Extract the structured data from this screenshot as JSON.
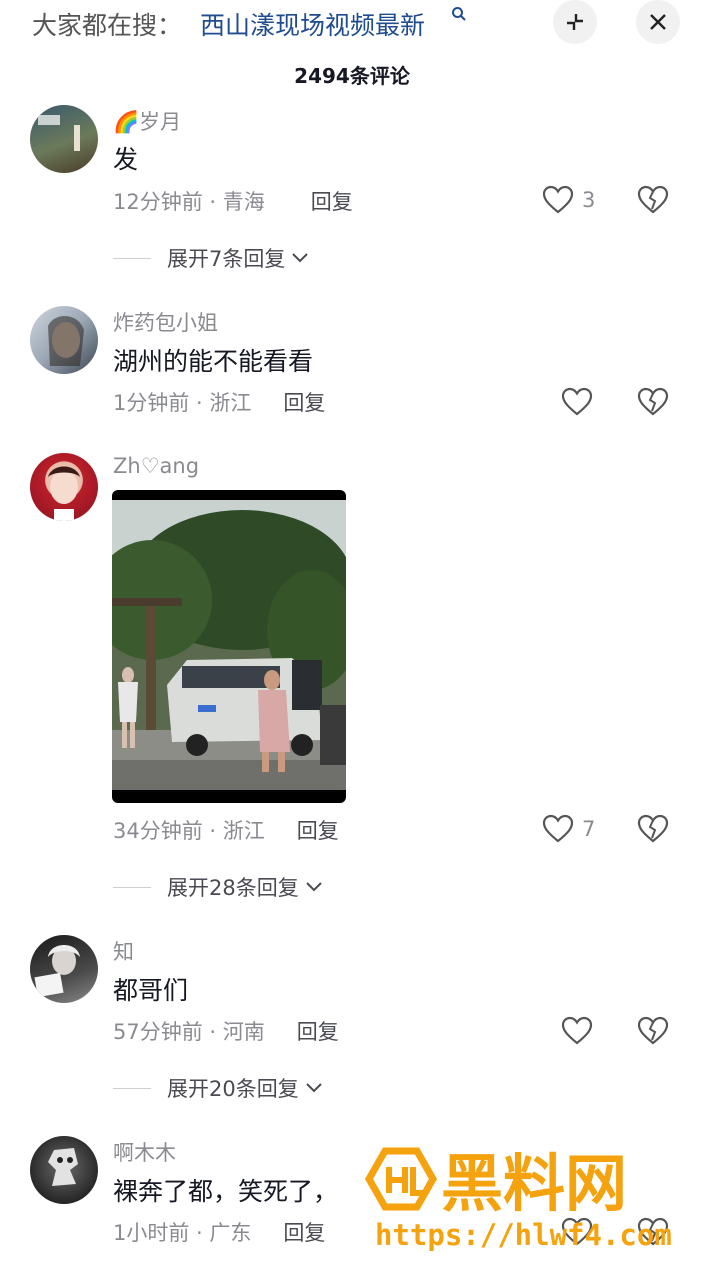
{
  "header": {
    "search_prefix": "大家都在搜：",
    "search_term": "西山漾现场视频最新",
    "comment_count": "2494条评论"
  },
  "comments": [
    {
      "username": "🌈岁月",
      "text": "发",
      "time": "12分钟前 · 青海",
      "reply_label": "回复",
      "likes": "3",
      "expand_label": "展开7条回复"
    },
    {
      "username": "炸药包小姐",
      "text": "湖州的能不能看看",
      "time": "1分钟前 · 浙江",
      "reply_label": "回复",
      "likes": ""
    },
    {
      "username": "Zh♡ang",
      "text": "",
      "time": "34分钟前 · 浙江",
      "reply_label": "回复",
      "likes": "7",
      "expand_label": "展开28条回复"
    },
    {
      "username": "知",
      "text": "都哥们",
      "time": "57分钟前 · 河南",
      "reply_label": "回复",
      "likes": "",
      "expand_label": "展开20条回复"
    },
    {
      "username": "啊木木",
      "text": "裸奔了都，笑死了，",
      "time": "1小时前 · 广东",
      "reply_label": "回复",
      "likes": ""
    }
  ],
  "watermark": {
    "title": "黑料网",
    "url": "https://hlwf4.com"
  },
  "colors": {
    "link": "#1f4b8f",
    "watermark": "#f5a20f"
  },
  "icons": [
    "search-icon",
    "collapse-icon",
    "close-icon",
    "heart-icon",
    "broken-heart-icon",
    "chevron-down-icon"
  ]
}
